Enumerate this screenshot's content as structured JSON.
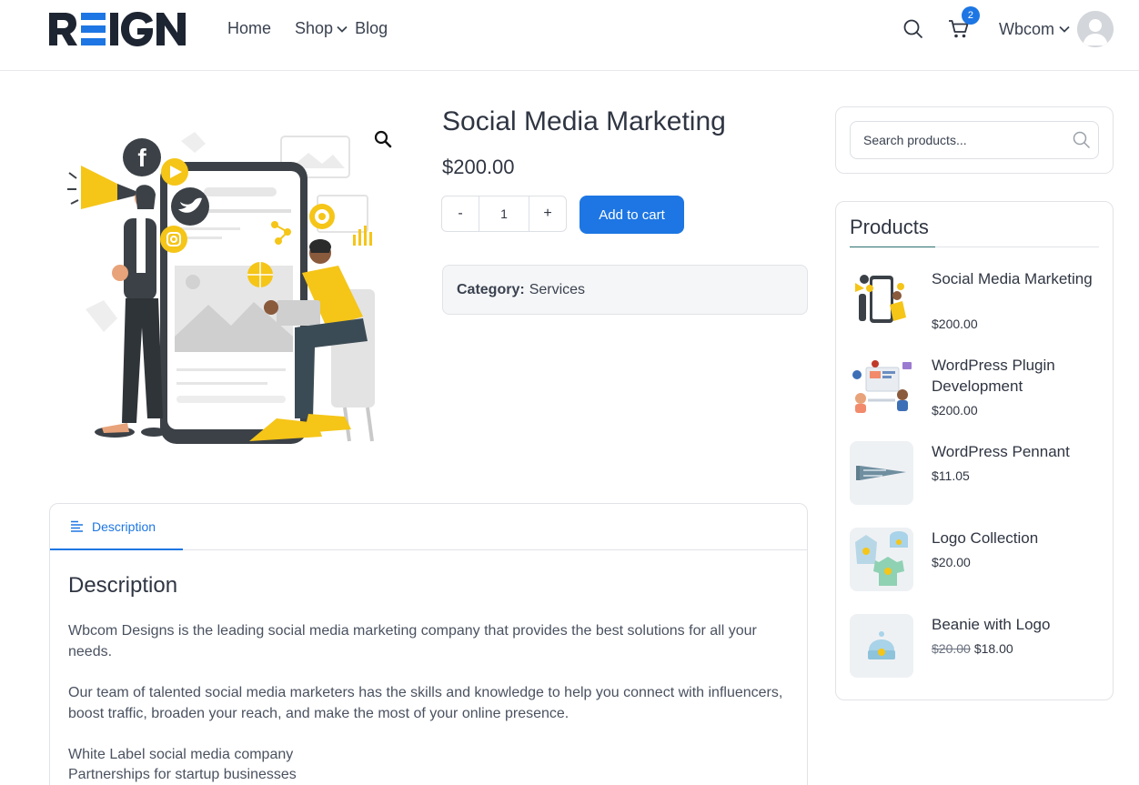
{
  "header": {
    "logo_text": "REIGN",
    "nav": [
      {
        "label": "Home"
      },
      {
        "label": "Shop"
      },
      {
        "label": "Blog"
      }
    ],
    "cart_count": "2",
    "user_name": "Wbcom"
  },
  "product": {
    "title": "Social Media Marketing",
    "price": "$200.00",
    "qty_minus": "-",
    "qty_value": "1",
    "qty_plus": "+",
    "add_to_cart": "Add to cart",
    "category_label": "Category:",
    "category_value": "Services"
  },
  "tabs": {
    "active_tab": "Description",
    "heading": "Description",
    "paragraphs": [
      "Wbcom Designs is the leading social media marketing company that provides the best solutions for all your needs.",
      "Our team of talented social media marketers has the skills and knowledge to help you connect with influencers, boost traffic, broaden your reach, and make the most of your online presence.",
      "White Label social media company",
      "Partnerships for startup businesses"
    ]
  },
  "sidebar": {
    "search_placeholder": "Search products...",
    "widget_title": "Products",
    "products": [
      {
        "name": "Social Media Marketing",
        "price": "$200.00",
        "old_price": ""
      },
      {
        "name": "WordPress Plugin Development",
        "price": "$200.00",
        "old_price": ""
      },
      {
        "name": "WordPress Pennant",
        "price": "$11.05",
        "old_price": ""
      },
      {
        "name": "Logo Collection",
        "price": "$20.00",
        "old_price": ""
      },
      {
        "name": "Beanie with Logo",
        "price": "$18.00",
        "old_price": "$20.00"
      }
    ]
  },
  "colors": {
    "accent": "#1d76e3",
    "text": "#2f3542",
    "illustration_yellow": "#f5c518"
  },
  "icons": [
    "search-icon",
    "cart-icon",
    "chevron-down-icon",
    "user-avatar-icon",
    "zoom-icon",
    "description-tab-icon"
  ]
}
